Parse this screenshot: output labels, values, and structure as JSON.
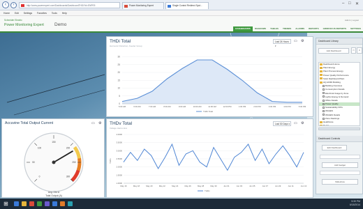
{
  "browser": {
    "address": "http://www.powerexpert.com/Dashboards/DashboardTHDi?id=ENPE5",
    "tabs": [
      {
        "label": "Power Monitoring Expert"
      },
      {
        "label": "Single Control Redirect Syst..."
      }
    ],
    "menu": [
      "Home",
      "Edit",
      "Settings",
      "Favorites",
      "Tools",
      "Help"
    ],
    "colors": {
      "tab_fav_1": "#d84a3a",
      "tab_fav_2": "#3a7ad8"
    }
  },
  "app": {
    "brand_top": "Schneider Electric",
    "brand_main": "Power Monitoring Expert",
    "section": "Demo",
    "user": "Admin | Logout",
    "nav": [
      "DASHBOARDS",
      "DIAGRAMS",
      "TABLES",
      "TRENDS",
      "ALARMS",
      "REPORTS",
      "GRIDFOCUS REPORTS",
      "SETTINGS"
    ],
    "active_nav": 0,
    "accent": "#3f9a3f"
  },
  "panels": {
    "thdi_top": {
      "title": "THDi Total",
      "subtitle": "Harmonic Distortion, Feeder Group",
      "range": "Last 24 Hours",
      "legend": "THDi Total",
      "chart_data": {
        "type": "area",
        "x": [
          "5:00 AM",
          "6:00 AM",
          "7:00 AM",
          "8:00 AM",
          "9:00 AM",
          "10:00 AM",
          "11:00 AM",
          "12:00 PM",
          "1:00 PM",
          "2:00 PM",
          "3:00 PM",
          "4:00 PM",
          "5:00 PM"
        ],
        "values": [
          1.5,
          3.5,
          8.0,
          16.0,
          22.5,
          28.0,
          28.0,
          22.0,
          15.0,
          7.0,
          1.5,
          1.0,
          1.0
        ],
        "yticks": [
          "0",
          "5",
          "10",
          "15",
          "20",
          "25",
          "30"
        ],
        "ylim": [
          0,
          32
        ],
        "series_color": "#5b8fd6",
        "fill_color": "#dde8f7"
      }
    },
    "thdv": {
      "title": "THDv Total",
      "subtitle": "Voltage Harmonics",
      "range": "Last 30 Days",
      "ylabel": "THDv",
      "legend": "THDv",
      "chart_data": {
        "type": "line",
        "x": [
          "May 16",
          "May 18",
          "May 20",
          "May 22",
          "May 24",
          "May 26",
          "May 28",
          "May 30",
          "Jun 01",
          "Jun 03",
          "Jun 05",
          "Jun 07",
          "Jun 09",
          "Jun 11",
          "Jun 13"
        ],
        "values": [
          2.3,
          2.9,
          2.4,
          3.1,
          2.7,
          1.9,
          2.6,
          3.4,
          2.1,
          2.8,
          3.0,
          2.3,
          2.0,
          3.2,
          2.5,
          1.8,
          2.6,
          2.9,
          3.4,
          2.4,
          3.1,
          2.2,
          2.8,
          3.3,
          2.7,
          2.0,
          2.9
        ],
        "yticks": [
          "1.0000",
          "1.5000",
          "2.0000",
          "2.5000",
          "3.0000",
          "3.5000",
          "4.0000"
        ],
        "ylim": [
          1.0,
          4.0
        ],
        "series_color": "#4f86d4"
      }
    },
    "gauge": {
      "title": "Accuvine Total Output Current",
      "footer_1": "Avg: 234 A",
      "footer_2": "Total Output (A)",
      "chart_data": {
        "type": "gauge",
        "value": 216,
        "min": 0,
        "max": 300,
        "ticks": [
          "0",
          "50",
          "100",
          "150",
          "200",
          "250",
          "300"
        ],
        "band_colors": [
          "#f2c94c",
          "#e67e22",
          "#e03b2b"
        ]
      }
    },
    "dashboard_library": {
      "title": "Dashboard Library",
      "add_button": "Add Dashboard",
      "tree": [
        {
          "label": "Dashboard Home",
          "kind": "folder"
        },
        {
          "label": "Plant Energy",
          "kind": "folder"
        },
        {
          "label": "Plant Process Energy",
          "kind": "folder"
        },
        {
          "label": "Power Quality Performance",
          "kind": "folder"
        },
        {
          "label": "Solar Dashboard Plant",
          "kind": "folder"
        },
        {
          "label": "HQ AFRD Building",
          "kind": "folder"
        },
        {
          "label": "Building Overview",
          "kind": "leaf"
        },
        {
          "label": "Consumption Details",
          "kind": "leaf"
        },
        {
          "label": "Electrical Usage by Zone",
          "kind": "leaf"
        },
        {
          "label": "Lights Energy & Demand",
          "kind": "leaf"
        },
        {
          "label": "Office Details",
          "kind": "leaf"
        },
        {
          "label": "Power Quality",
          "kind": "leaf",
          "selected": true
        },
        {
          "label": "Sustainability KPIs",
          "kind": "leaf"
        },
        {
          "label": "WAGES",
          "kind": "leaf"
        },
        {
          "label": "WAGES Details",
          "kind": "leaf"
        },
        {
          "label": "Zone Rankings",
          "kind": "leaf"
        },
        {
          "label": "Healthcare",
          "kind": "folder"
        },
        {
          "label": "Retail",
          "kind": "folder"
        }
      ],
      "controls_title": "Dashboard Controls",
      "controls_button": "Edit Dashboard",
      "apply_button": "Add Gadget",
      "slideshow_button": "Slideshow"
    }
  },
  "taskbar": {
    "clock_time": "5:30 PM",
    "clock_date": "6/18/2014",
    "icon_colors": [
      "#3a7ad8",
      "#e6b53c",
      "#d84a3a",
      "#3f9a3f",
      "#6a5acd",
      "#3a7ad8",
      "#e07b2a",
      "#2aa0b0"
    ]
  }
}
